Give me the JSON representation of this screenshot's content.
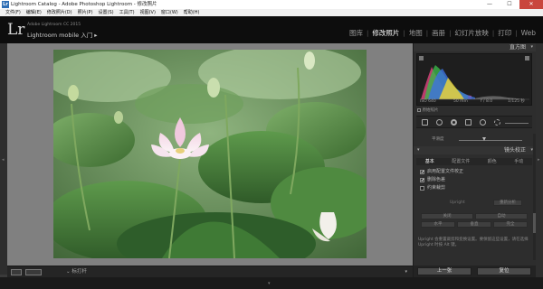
{
  "window": {
    "title": "Lightroom Catalog - Adobe Photoshop Lightroom - 修改照片",
    "minimize": "—",
    "maximize": "☐",
    "close": "✕",
    "app_icon": "Lr"
  },
  "menubar": {
    "items": [
      "文件(F)",
      "编辑(E)",
      "修改照片(D)",
      "照片(P)",
      "设置(S)",
      "工具(T)",
      "视图(V)",
      "窗口(W)",
      "帮助(H)"
    ]
  },
  "identity": {
    "logo": "Lr",
    "version": "Adobe Lightroom CC 2015",
    "mobile": "Lightroom mobile 入门 ▸"
  },
  "modules": [
    "图库",
    "修改照片",
    "地图",
    "画册",
    "幻灯片放映",
    "打印",
    "Web"
  ],
  "active_module": "修改照片",
  "toolbar": {
    "flag_label": "⌄  标打杆",
    "dropdown_icon": "chevron-down-icon"
  },
  "right_panel": {
    "histogram_title": "直方图",
    "readouts": [
      "ISO 640",
      "50 mm",
      "f / 8.0",
      "1/125 秒"
    ],
    "original_photo_label": "原始照片",
    "tool_row_label": "平滑度",
    "lens_title": "镜头校正",
    "lens_tabs": [
      "基本",
      "配置文件",
      "颜色",
      "手动"
    ],
    "active_lens_tab": "基本",
    "checks": [
      {
        "label": "启用配置文件校正",
        "checked": true
      },
      {
        "label": "删除色差",
        "checked": true
      },
      {
        "label": "约束裁剪",
        "checked": false
      }
    ],
    "upright_label": "Upright",
    "reanalyze": "重新分析",
    "upright_buttons_row1": [
      "关闭",
      "自动"
    ],
    "upright_buttons_row2": [
      "水平",
      "垂直",
      "完全"
    ],
    "note": "Upright 会重置裁剪和变换设置。要保留这些设置，请在选择 Upright 时按 Alt 键。",
    "previous_button": "上一张",
    "reset_button": "复位"
  },
  "colors": {
    "accent": "#ffffff",
    "panel_bg": "#2d2d2d",
    "viewport_bg": "#808080"
  }
}
